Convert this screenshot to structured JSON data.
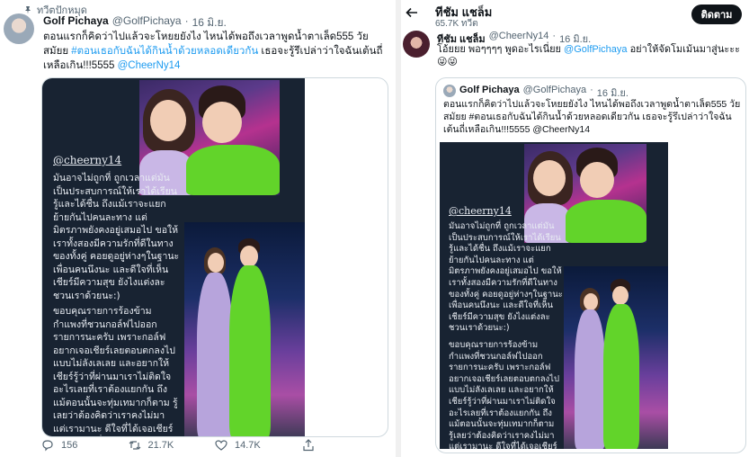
{
  "left_tweet": {
    "pinned_label": "ทวีตปักหมุด",
    "author_name": "Golf Pichaya",
    "author_handle": "@GolfPichaya",
    "dot": "·",
    "date": "16 มิ.ย.",
    "text_part1": "ตอนแรกก็คิดว่าไปแล้วจะโหยยยังไง ไหนได้พอถึงเวลาพูดน้ำตาเล็ด555 วัยสมัยย",
    "hashtag": "#ตอนเธอกับฉันได้กินน้ำด้วยหลอดเดียวกัน",
    "text_part2": " เธอจะรู้รึเปล่าว่าใจฉันเต้นถี่เหลือเกิน!!!5555 ",
    "mention": "@CheerNy14",
    "actions": {
      "reply_count": "156",
      "retweet_count": "21.7K",
      "like_count": "14.7K"
    }
  },
  "poster": {
    "handle": "@cheerny14",
    "para1": "มันอาจไม่ถูกที่ ถูกเวลาแต่มันเป็นประสบการณ์ให้เราได้เรียนรู้และได้ชื่น ถึงแม้เราจะแยกย้ายกันไปคนละทาง แต่มิตรภาพยังคงอยู่เสมอไป ขอให้เราทั้งสองมีความรักที่ดีในทางของทั้งคู่ คอยดูอยู่ห่างๆในฐานะเพื่อนคนนึงนะ และดีใจที่เห็นเชียร์มีความสุข ยังไงแต่งละชวนเราด้วยนะ:)",
    "para2": "ขอบคุณรายการร้องข้ามกำแพงที่ชวนกอล์ฟไปออกรายการนะครับ เพราะกอล์ฟอยากเจอเชียร์เลยตอบตกลงไปแบบไม่ลังเลเลย และอยากให้เชียร์รู้ว่าที่ผ่านมาเราไม่ติดใจอะไรเลยที่เราต้องแยกกัน ถึงแม้ตอนนั้นจะทุ่มเทมากก็ตาม รู้เลยว่าต้องคิดว่าเราคงไม่มา แต่เรามานะ ดีใจที่ได้เจอเชียร์นะ :) ตอนที่"
  },
  "right_panel": {
    "header_title": "ทีชัม แชล็ม",
    "header_subtitle": "65.7K ทวีต",
    "follow_label": "ติดตาม",
    "reply": {
      "author_name": "ทีชัม แชล็ม",
      "author_handle": "@CheerNy14",
      "dot": "·",
      "date": "16 มิ.ย.",
      "text_part1": "โอ้ยยย พอๆๆๆๆ พูดอะไรเนี่ยย ",
      "mention": "@GolfPichaya",
      "text_part2": " อย่าให้จัดโมเม้นมาสู่นะะะ😜😜"
    },
    "quote": {
      "author_name": "Golf Pichaya",
      "author_handle": "@GolfPichaya",
      "dot": "·",
      "date": "16 มิ.ย.",
      "text": "ตอนแรกก็คิดว่าไปแล้วจะโหยยยังไง ไหนได้พอถึงเวลาพูดน้ำตาเล็ด555 วัยสมัยย #ตอนเธอกับฉันได้กินน้ำด้วยหลอดเดียวกัน เธอจะรู้รึเปล่าว่าใจฉันเต้นถี่เหลือเกิน!!!5555 @CheerNy14"
    }
  },
  "colors": {
    "link": "#1d9bf0",
    "poster_bg": "#182332",
    "green_suit": "#62d42a",
    "lilac_suit": "#b7a4dc"
  },
  "icons": [
    "pin-icon",
    "reply-icon",
    "retweet-icon",
    "like-icon",
    "share-icon",
    "back-arrow-icon"
  ]
}
